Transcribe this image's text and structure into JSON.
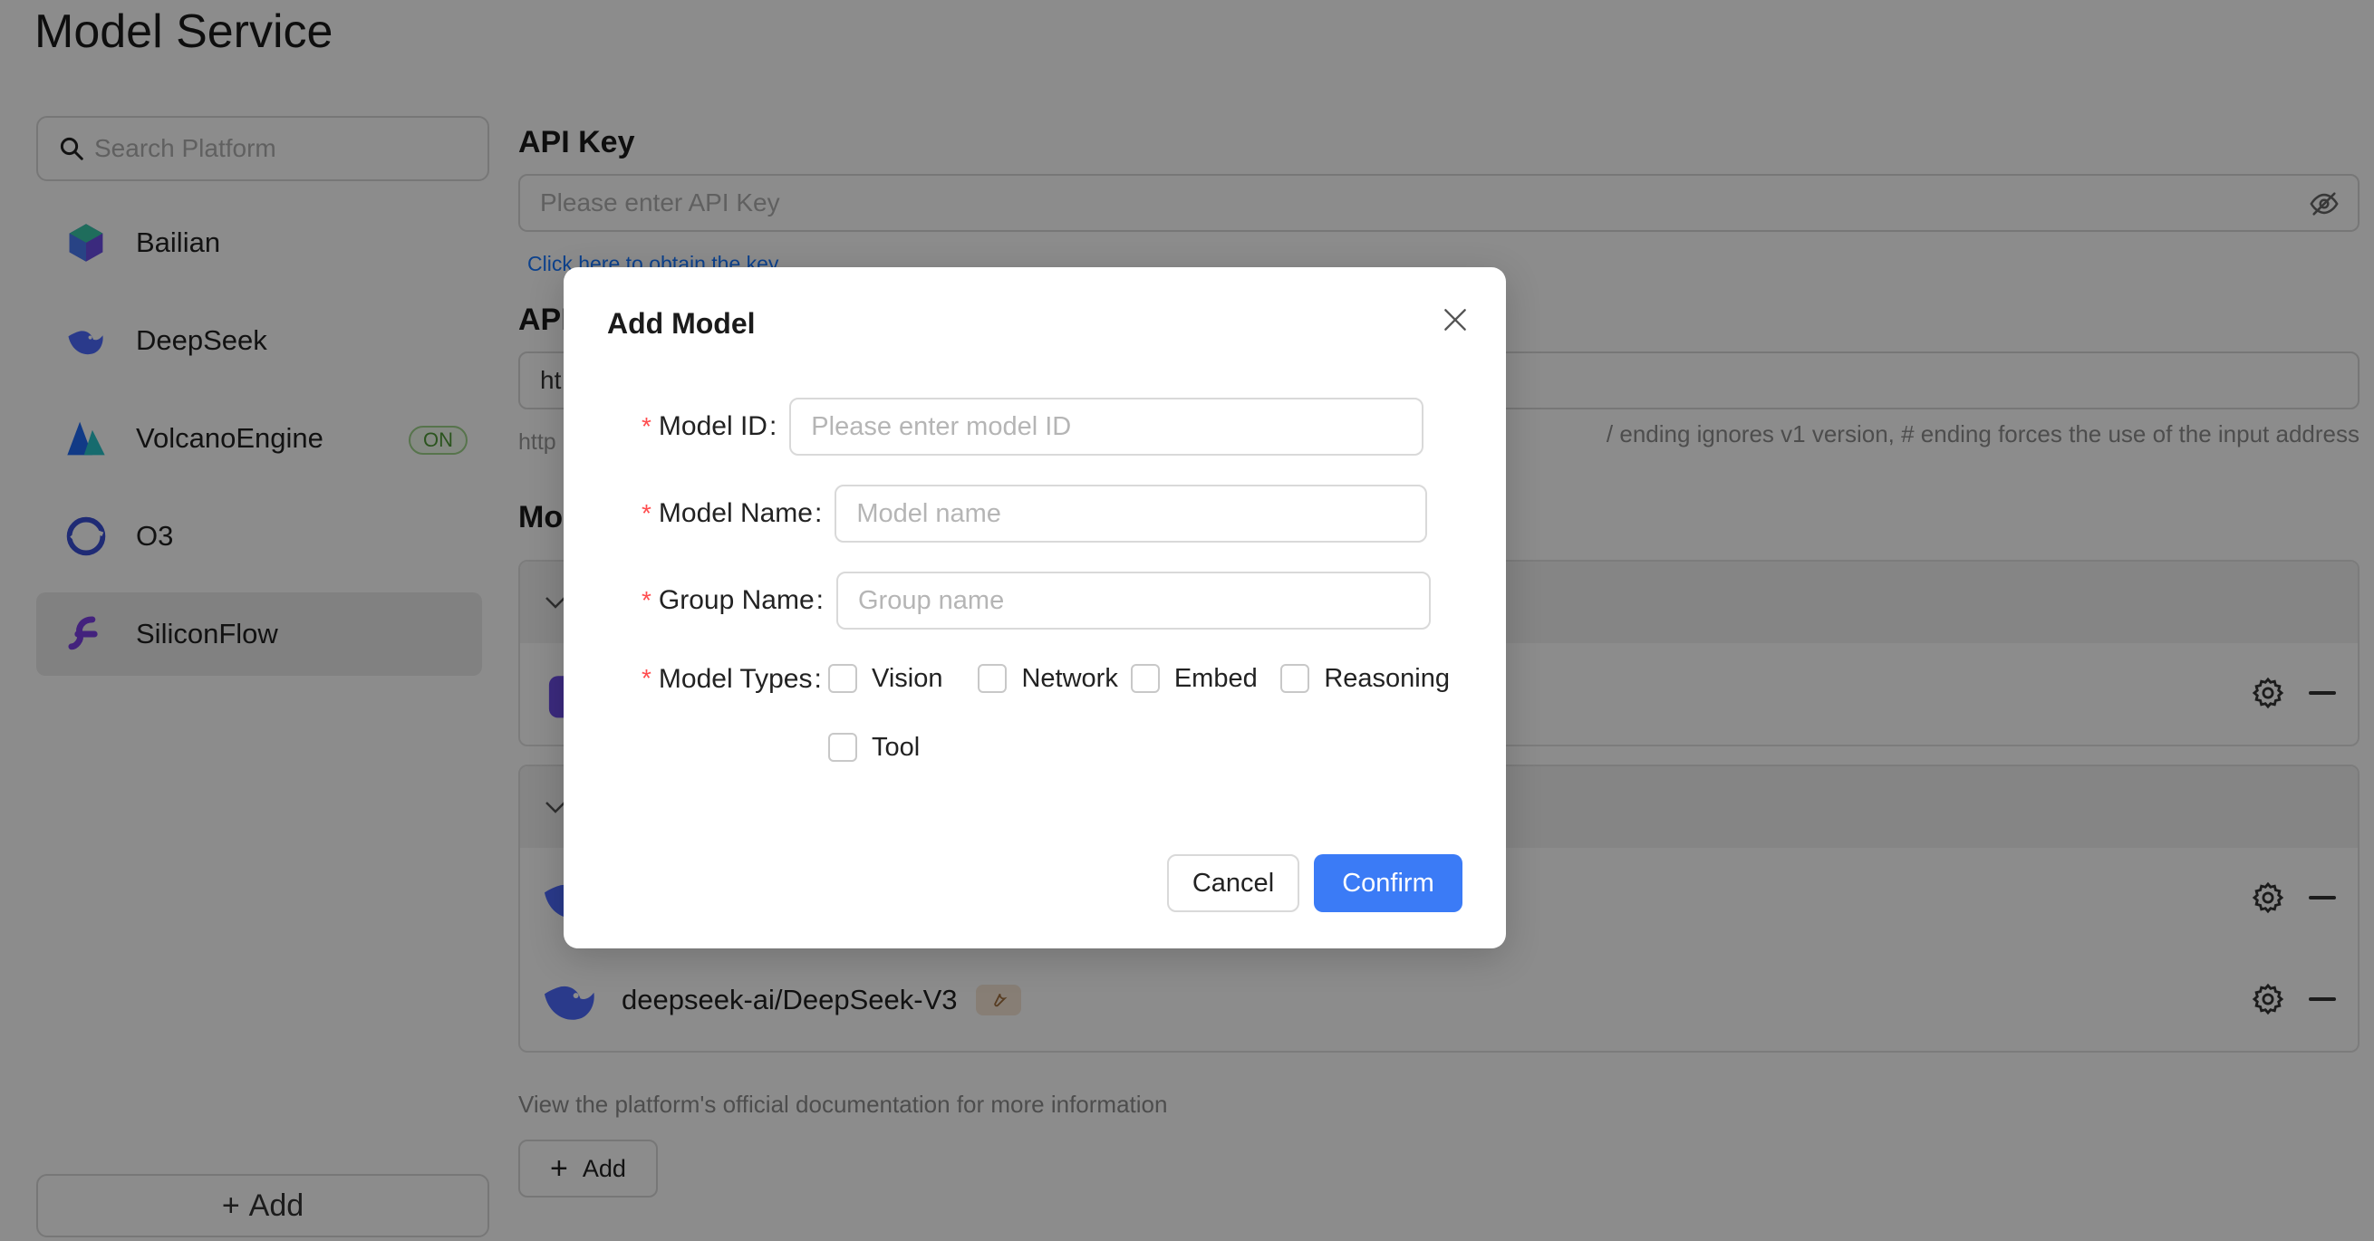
{
  "page": {
    "title": "Model Service"
  },
  "sidebar": {
    "search_placeholder": "Search Platform",
    "platforms": [
      {
        "name": "Bailian",
        "icon": "bailian-logo-icon",
        "active": false
      },
      {
        "name": "DeepSeek",
        "icon": "deepseek-logo-icon",
        "active": false
      },
      {
        "name": "VolcanoEngine",
        "icon": "volcano-logo-icon",
        "badge": "ON",
        "active": false
      },
      {
        "name": "O3",
        "icon": "o3-logo-icon",
        "active": false
      },
      {
        "name": "SiliconFlow",
        "icon": "siliconflow-logo-icon",
        "active": true
      }
    ],
    "add_label": "Add",
    "add_icon": "+"
  },
  "main": {
    "api_key": {
      "label": "API Key",
      "placeholder": "Please enter API Key",
      "obtain_link": "Click here to obtain the key"
    },
    "api_host": {
      "label": "API",
      "value": "ht",
      "hint_prefix": "http",
      "hint": "/ ending ignores v1 version, # ending forces the use of the input address"
    },
    "models_label": "Mo",
    "groups": [
      {
        "models": [
          {
            "name": ""
          }
        ]
      },
      {
        "models": [
          {
            "name": ""
          },
          {
            "name": "deepseek-ai/DeepSeek-V3",
            "badge_icon": "wrench-icon"
          }
        ]
      }
    ],
    "doc_hint": "View the platform's official documentation for more information",
    "add_label": "Add"
  },
  "modal": {
    "title": "Add Model",
    "fields": {
      "model_id": {
        "label": "Model ID",
        "placeholder": "Please enter model ID",
        "value": ""
      },
      "model_name": {
        "label": "Model Name",
        "placeholder": "Model name",
        "value": ""
      },
      "group_name": {
        "label": "Group Name",
        "placeholder": "Group name",
        "value": ""
      }
    },
    "model_types": {
      "label": "Model Types",
      "options": [
        "Vision",
        "Network",
        "Embed",
        "Reasoning",
        "Tool"
      ]
    },
    "required_mark": "*",
    "colon": ":",
    "cancel_label": "Cancel",
    "confirm_label": "Confirm"
  },
  "colors": {
    "primary": "#3b7bf6",
    "required": "#ff4d4f",
    "link": "#1677ff",
    "on_badge": "#4f9a37",
    "overlay": "rgba(0,0,0,0.45)"
  }
}
